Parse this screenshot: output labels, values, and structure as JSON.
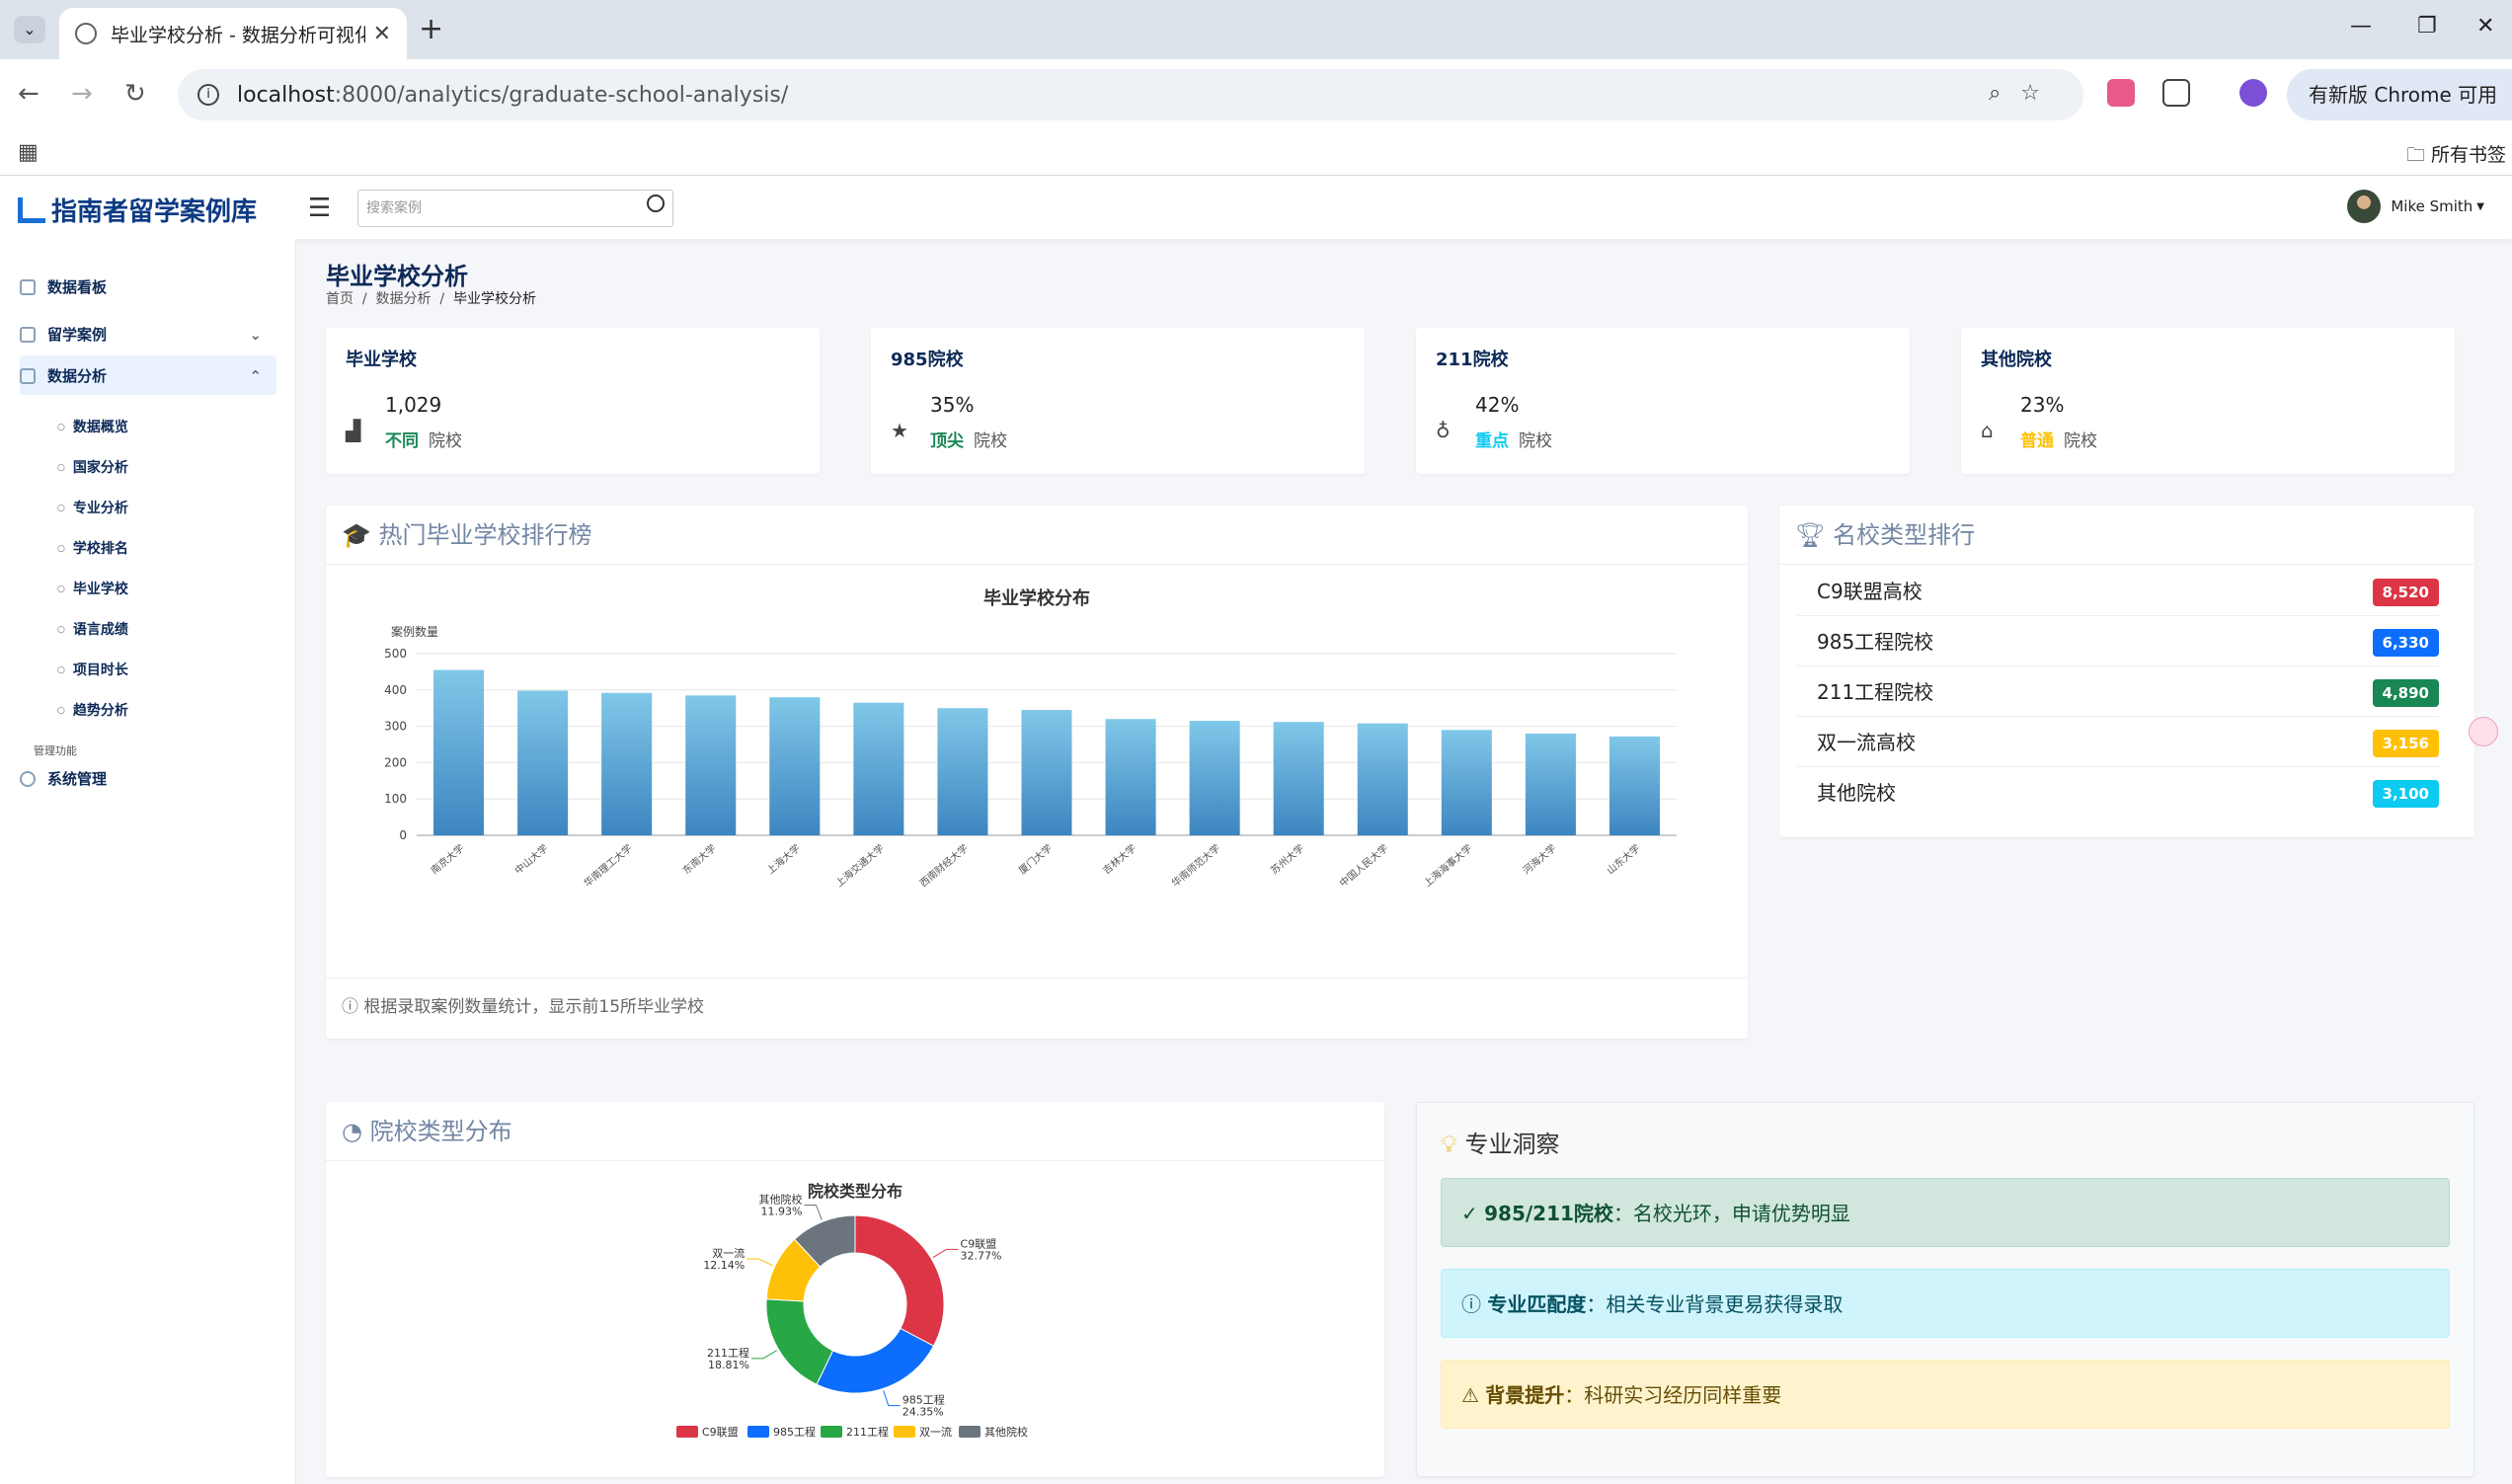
{
  "browser": {
    "tab_title": "毕业学校分析 - 数据分析可视化",
    "url_host": "localhost",
    "url_rest": ":8000/analytics/graduate-school-analysis/",
    "update_label": "有新版 Chrome 可用",
    "all_bookmarks": "所有书签"
  },
  "app": {
    "logo": "指南者留学案例库",
    "search_placeholder": "搜索案例",
    "user_name": "Mike Smith"
  },
  "sidebar": {
    "items": [
      "数据看板",
      "留学案例",
      "数据分析"
    ],
    "sub_items": [
      "数据概览",
      "国家分析",
      "专业分析",
      "学校排名",
      "毕业学校",
      "语言成绩",
      "项目时长",
      "趋势分析"
    ],
    "section": "管理功能",
    "admin": "系统管理"
  },
  "page": {
    "title": "毕业学校分析",
    "crumbs": [
      "首页",
      "数据分析",
      "毕业学校分析"
    ]
  },
  "stats": [
    {
      "title": "毕业学校",
      "value": "1,029",
      "tag": "不同",
      "tag_color": "#198754",
      "unit": "院校",
      "icon": "chart-icon"
    },
    {
      "title": "985院校",
      "value": "35%",
      "tag": "顶尖",
      "tag_color": "#198754",
      "unit": "院校",
      "icon": "star-icon"
    },
    {
      "title": "211院校",
      "value": "42%",
      "tag": "重点",
      "tag_color": "#0dcaf0",
      "unit": "院校",
      "icon": "award-icon"
    },
    {
      "title": "其他院校",
      "value": "23%",
      "tag": "普通",
      "tag_color": "#ffc107",
      "unit": "院校",
      "icon": "graduation-cap-icon"
    }
  ],
  "bar_card": {
    "header": "热门毕业学校排行榜",
    "footer": "根据录取案例数量统计，显示前15所毕业学校"
  },
  "rank_card": {
    "header": "名校类型排行",
    "rows": [
      {
        "label": "C9联盟高校",
        "value": "8,520",
        "color": "#dc3545"
      },
      {
        "label": "985工程院校",
        "value": "6,330",
        "color": "#0d6efd"
      },
      {
        "label": "211工程院校",
        "value": "4,890",
        "color": "#198754"
      },
      {
        "label": "双一流高校",
        "value": "3,156",
        "color": "#ffc107"
      },
      {
        "label": "其他院校",
        "value": "3,100",
        "color": "#0dcaf0"
      }
    ]
  },
  "pie_card": {
    "header": "院校类型分布"
  },
  "insight_card": {
    "header": "专业洞察",
    "items": [
      {
        "bold": "985/211院校",
        "text": "：名校光环，申请优势明显",
        "bg": "#d1e7dd",
        "fg": "#0f5132",
        "border": "#badbcc"
      },
      {
        "bold": "专业匹配度",
        "text": "：相关专业背景更易获得录取",
        "bg": "#cff4fc",
        "fg": "#055160",
        "border": "#b6effb"
      },
      {
        "bold": "背景提升",
        "text": "：科研实习经历同样重要",
        "bg": "#fff3cd",
        "fg": "#664d03",
        "border": "#ffecb5"
      }
    ]
  },
  "chart_data": [
    {
      "type": "bar",
      "title": "毕业学校分布",
      "ylabel": "案例数量",
      "ylim": [
        0,
        500
      ],
      "yticks": [
        0,
        100,
        200,
        300,
        400,
        500
      ],
      "categories": [
        "南京大学",
        "中山大学",
        "华南理工大学",
        "东南大学",
        "上海大学",
        "上海交通大学",
        "西南财经大学",
        "厦门大学",
        "吉林大学",
        "华南师范大学",
        "苏州大学",
        "中国人民大学",
        "上海海事大学",
        "河海大学",
        "山东大学"
      ],
      "values": [
        455,
        398,
        392,
        385,
        380,
        365,
        350,
        345,
        320,
        315,
        312,
        308,
        290,
        280,
        272
      ],
      "colors": [
        "#80c8e8",
        "#3d85c0"
      ]
    },
    {
      "type": "pie",
      "title": "院校类型分布",
      "slices": [
        {
          "label": "C9联盟",
          "value": 32.77,
          "text": "32.77%",
          "color": "#dc3545"
        },
        {
          "label": "985工程",
          "value": 24.35,
          "text": "24.35%",
          "color": "#0d6efd"
        },
        {
          "label": "211工程",
          "value": 18.81,
          "text": "18.81%",
          "color": "#28a745"
        },
        {
          "label": "双一流",
          "value": 12.14,
          "text": "12.14%",
          "color": "#ffc107"
        },
        {
          "label": "其他院校",
          "value": 11.93,
          "text": "11.93%",
          "color": "#6c757d"
        }
      ]
    }
  ]
}
